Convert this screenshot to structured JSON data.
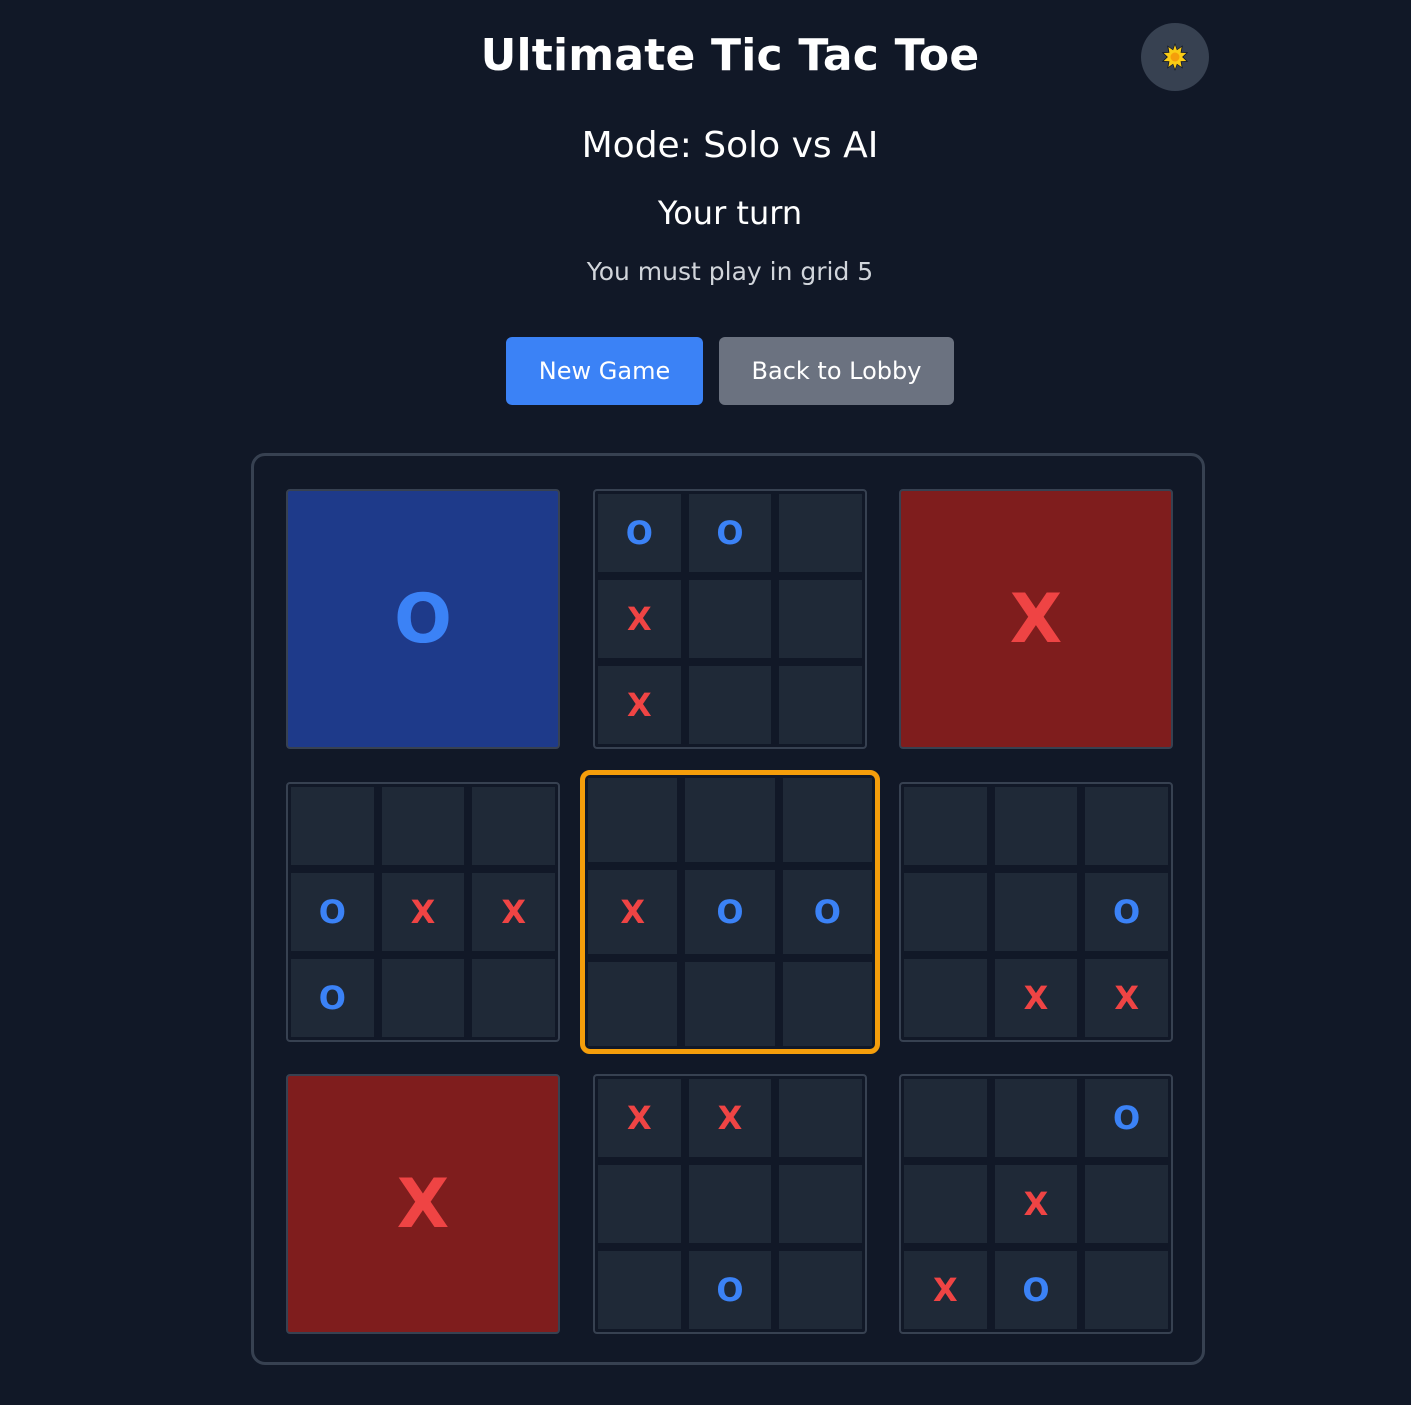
{
  "header": {
    "title": "Ultimate Tic Tac Toe",
    "theme_icon": "☀️"
  },
  "status": {
    "mode": "Mode: Solo vs AI",
    "turn": "Your turn",
    "hint": "You must play in grid 5"
  },
  "buttons": {
    "new_game": "New Game",
    "back_to_lobby": "Back to Lobby"
  },
  "colors": {
    "background": "#111827",
    "x": "#ef4444",
    "o": "#3b82f6",
    "active_border": "#f59e0b",
    "won_x_bg": "#7f1d1d",
    "won_o_bg": "#1e3a8a"
  },
  "board": {
    "active_grid": 5,
    "grids": [
      {
        "winner": "O",
        "cells": [
          "",
          "",
          "",
          "",
          "",
          "",
          "",
          "",
          ""
        ]
      },
      {
        "winner": "",
        "cells": [
          "O",
          "O",
          "",
          "X",
          "",
          "",
          "X",
          "",
          ""
        ]
      },
      {
        "winner": "X",
        "cells": [
          "",
          "",
          "",
          "",
          "",
          "",
          "",
          "",
          ""
        ]
      },
      {
        "winner": "",
        "cells": [
          "",
          "",
          "",
          "O",
          "X",
          "X",
          "O",
          "",
          ""
        ]
      },
      {
        "winner": "",
        "cells": [
          "",
          "",
          "",
          "X",
          "O",
          "O",
          "",
          "",
          ""
        ]
      },
      {
        "winner": "",
        "cells": [
          "",
          "",
          "",
          "",
          "",
          "O",
          "",
          "X",
          "X"
        ]
      },
      {
        "winner": "X",
        "cells": [
          "",
          "",
          "",
          "",
          "",
          "",
          "",
          "",
          ""
        ]
      },
      {
        "winner": "",
        "cells": [
          "X",
          "X",
          "",
          "",
          "",
          "",
          "",
          "O",
          ""
        ]
      },
      {
        "winner": "",
        "cells": [
          "",
          "",
          "O",
          "",
          "X",
          "",
          "X",
          "O",
          ""
        ]
      }
    ]
  }
}
